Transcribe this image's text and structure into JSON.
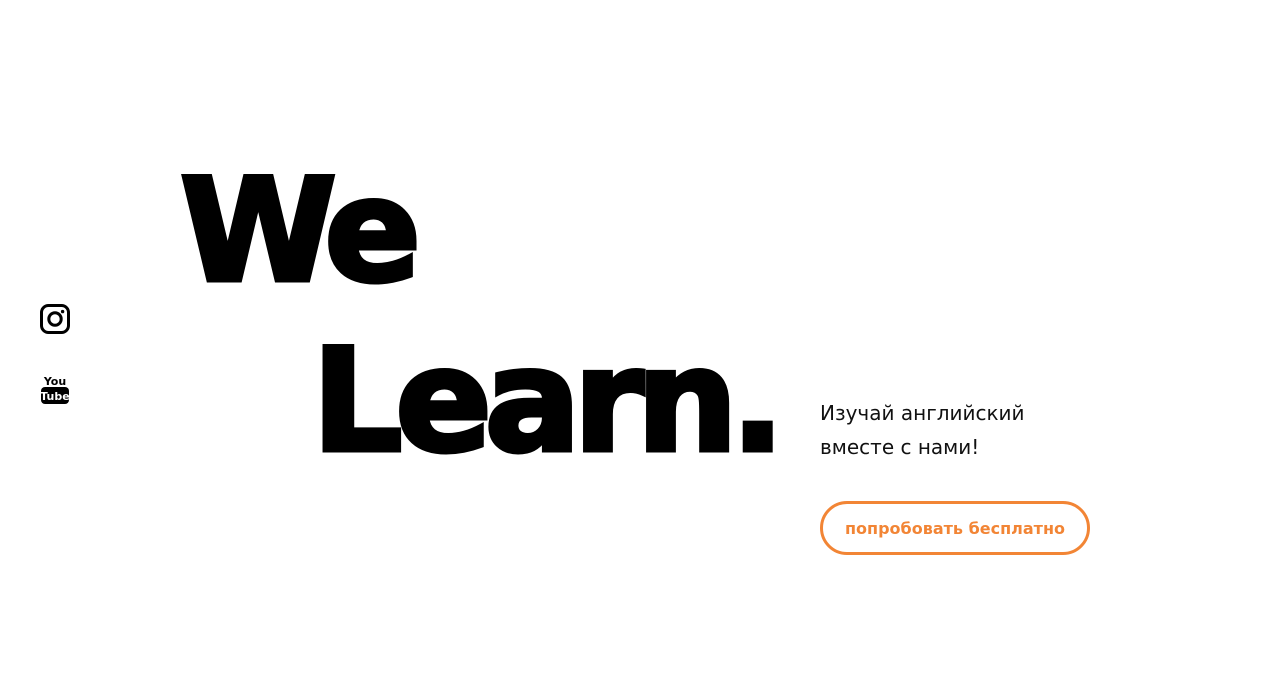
{
  "social": {
    "icons": [
      "instagram-icon",
      "youtube-icon"
    ],
    "youtube_text": [
      "You",
      "Tube"
    ]
  },
  "hero": {
    "line1": "We",
    "line2": "Learn."
  },
  "tagline": {
    "line1": "Изучай английский",
    "line2": "вместе с нами!"
  },
  "cta": {
    "label": "попробовать бесплатно"
  },
  "colors": {
    "accent": "#f28535",
    "text": "#000000",
    "background": "#ffffff"
  }
}
